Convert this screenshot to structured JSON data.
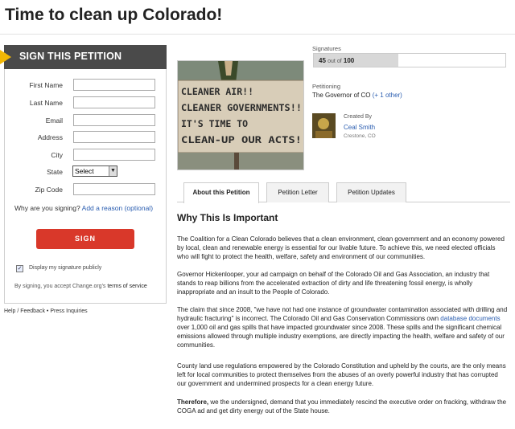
{
  "page": {
    "title": "Time to clean up Colorado!"
  },
  "sign_form": {
    "header": "SIGN THIS PETITION",
    "fields": {
      "first_name": "First Name",
      "last_name": "Last Name",
      "email": "Email",
      "address": "Address",
      "city": "City",
      "state": "State",
      "zip": "Zip Code"
    },
    "state_value": "Select",
    "why_prefix": "Why are you signing?",
    "why_link": "Add a reason (optional)",
    "sign_button": "SIGN",
    "display_checkbox_label": "Display my signature publicly",
    "display_checked": true,
    "terms_prefix": "By signing, you accept Change.org's",
    "terms_link": "terms of service"
  },
  "footer": {
    "links": "Help / Feedback • Press Inquiries"
  },
  "photo": {
    "sign_lines": [
      "CLEANER AIR!!",
      "CLEANER GOVERNMENTS!!",
      "IT'S TIME TO",
      "CLEAN-UP OUR ACTS!"
    ]
  },
  "signatures": {
    "label": "Signatures",
    "count": "45",
    "out_of": "out of",
    "goal": "100",
    "progress_fraction": 0.45
  },
  "petitioning": {
    "label": "Petitioning",
    "target": "The Governor of CO",
    "other": "(+ 1 other)"
  },
  "creator": {
    "label": "Created By",
    "name": "Ceal Smith",
    "location": "Crestone, CO"
  },
  "tabs": {
    "about": "About this Petition",
    "letter": "Petition Letter",
    "updates": "Petition Updates"
  },
  "content": {
    "heading": "Why This Is Important",
    "p1": "The Coalition for a Clean Colorado believes that a clean environment, clean government and an economy powered by local, clean and renewable energy is essential for our livable future. To achieve this, we need elected officials who will fight to protect the health, welfare, safety and environment of our communities.",
    "p2": "Governor Hickenlooper, your ad campaign on behalf of the Colorado Oil and Gas Association, an industry that stands to reap billions from the accelerated extraction of dirty and life threatening fossil energy, is wholly inappropriate and an insult to the People of Colorado.",
    "p3_a": "The claim that since 2008, \"we have not had one instance of groundwater contamination associated with drilling and hydraulic fracturing\" is incorrect. The Colorado Oil and Gas Conservation Commissions own",
    "p3_link": "database documents",
    "p3_b": "over 1,000 oil and gas spills that have impacted groundwater since 2008. These spills and the significant chemical emissions allowed through multiple industry exemptions, are directly impacting the health, welfare and safety of our communities.",
    "p4": "County land use regulations empowered by the Colorado Constitution and upheld by the courts, are the only means left for local communities to protect themselves from the abuses of an overly powerful industry that has corrupted our government and undermined prospects for a clean energy future.",
    "p5_bold": "Therefore,",
    "p5": "we the undersigned, demand that you immediately rescind the executive order on fracking, withdraw the COGA ad and get dirty energy out of the State house."
  }
}
